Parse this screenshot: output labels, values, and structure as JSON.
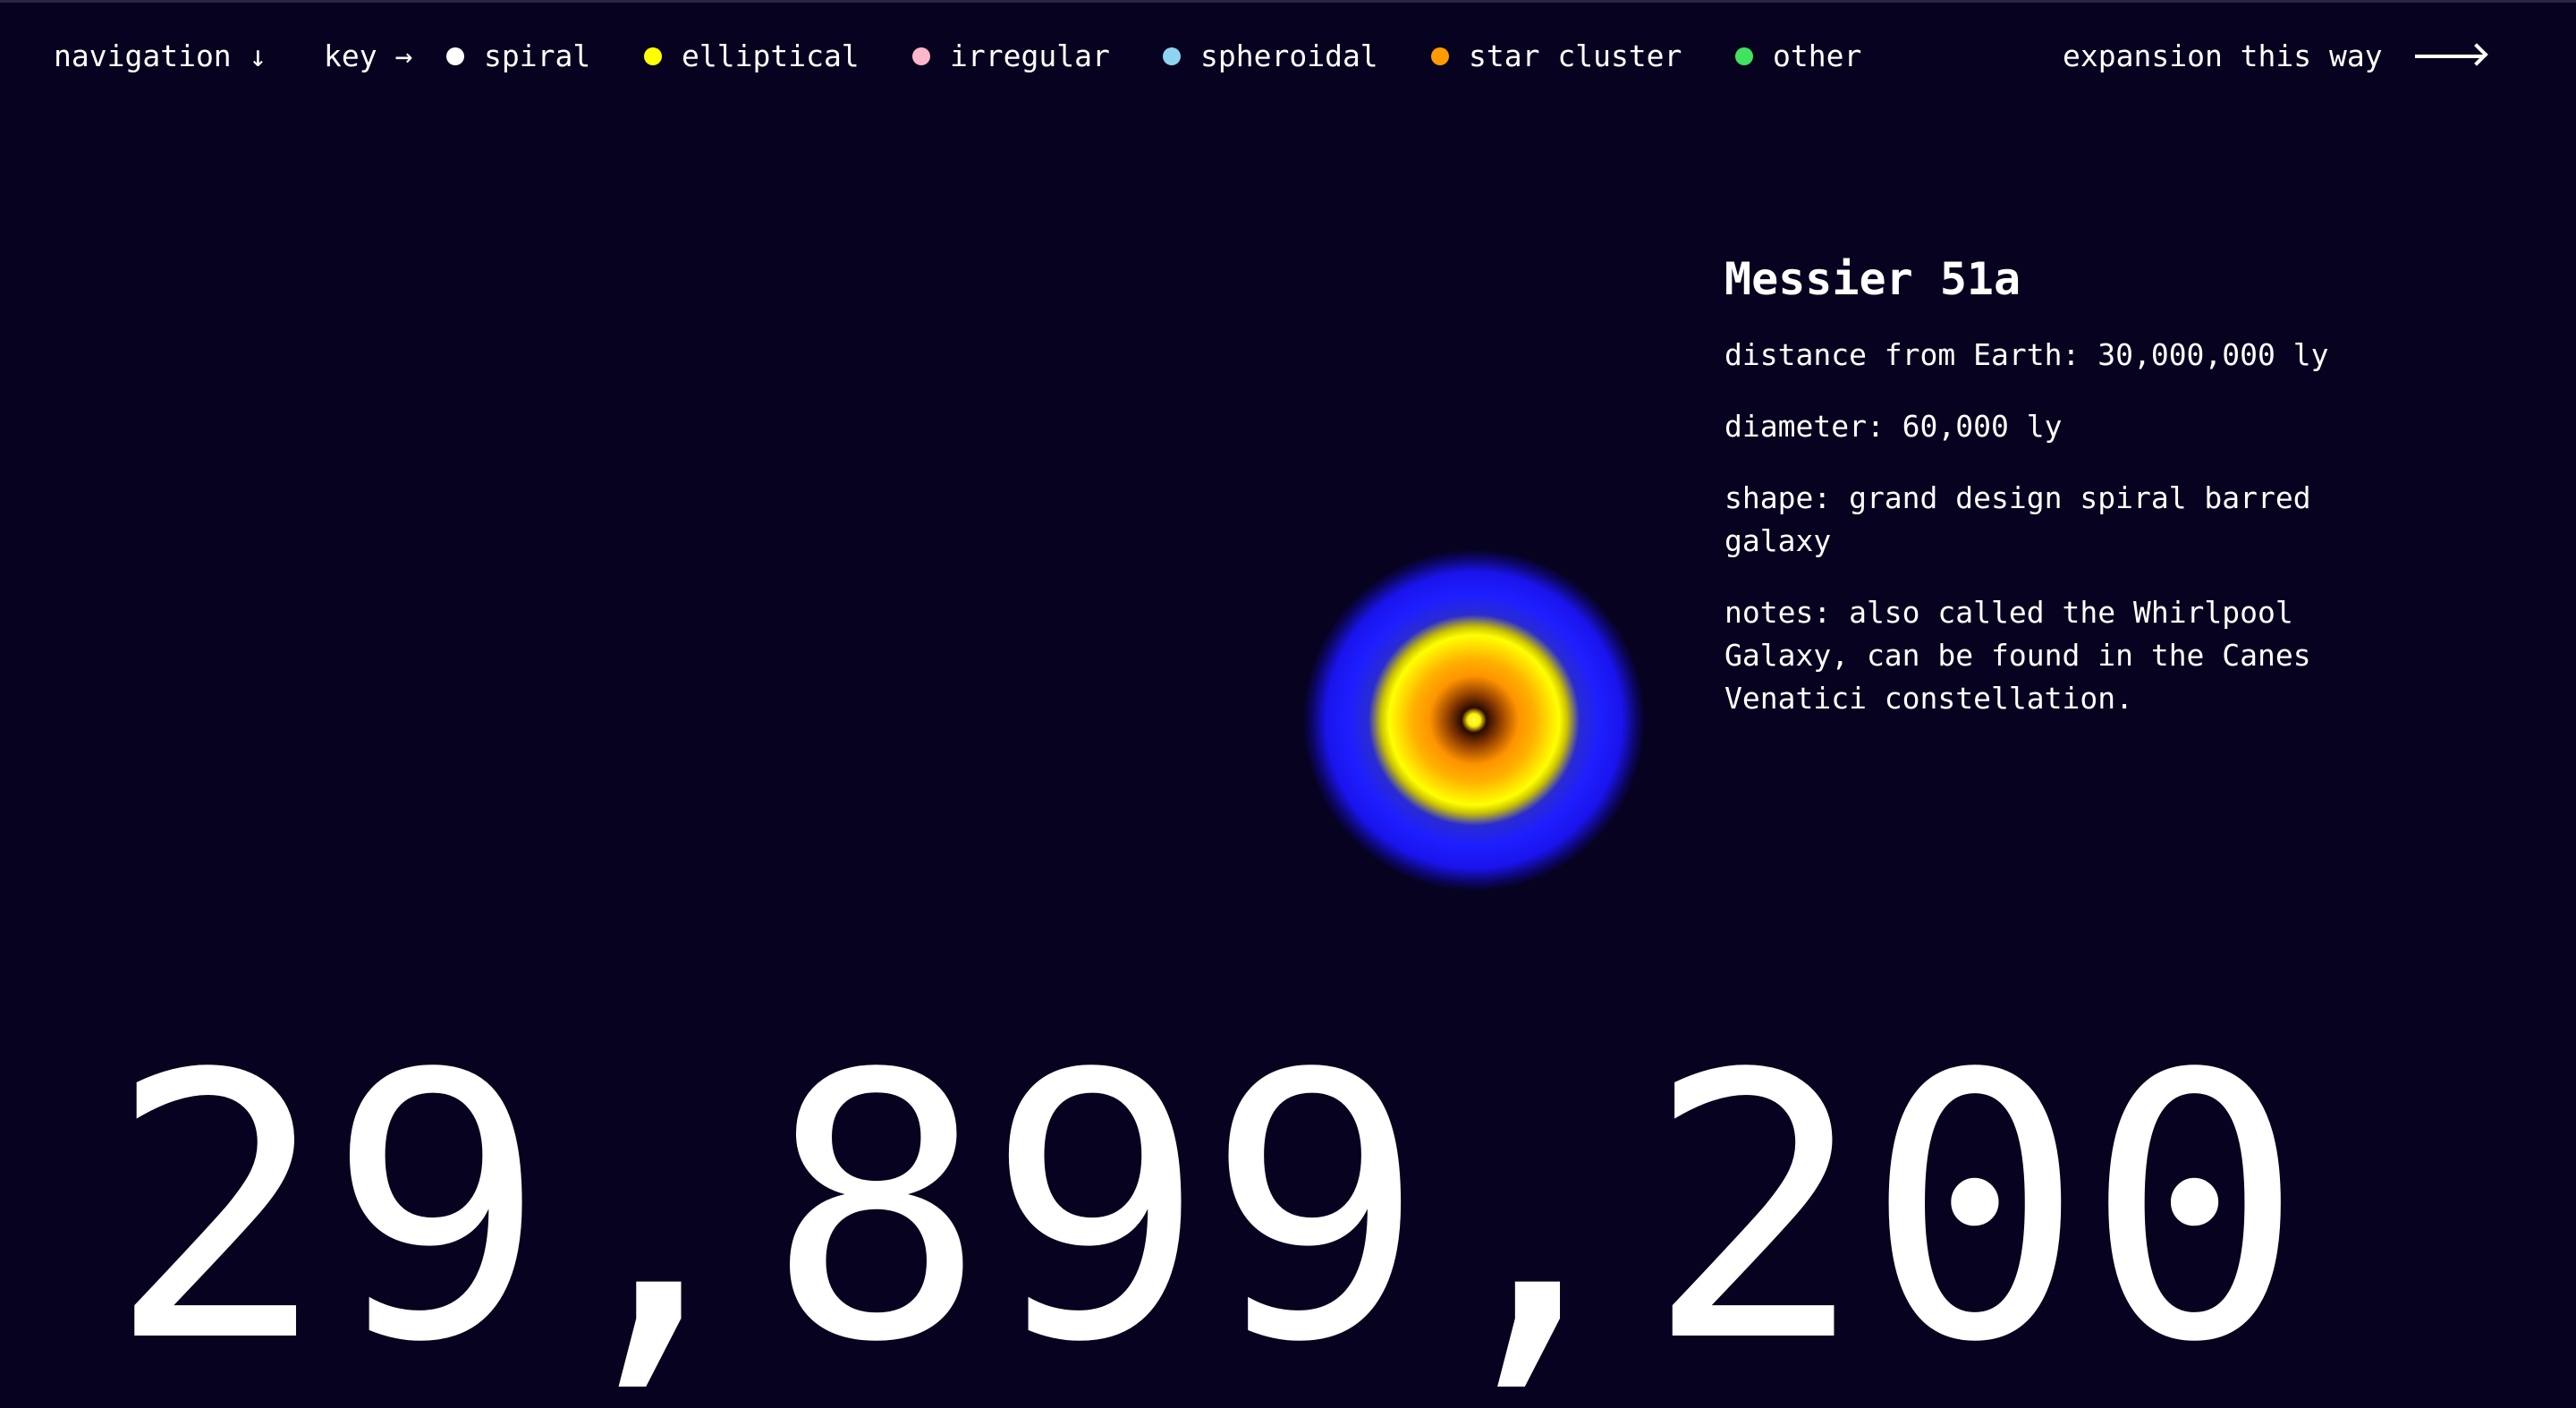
{
  "header": {
    "navigation_label": "navigation ↓",
    "key_label": "key →",
    "expansion_label": "expansion this way"
  },
  "legend": [
    {
      "label": "spiral",
      "color": "#ffffff"
    },
    {
      "label": "elliptical",
      "color": "#ffff00"
    },
    {
      "label": "irregular",
      "color": "#ffb6c8"
    },
    {
      "label": "spheroidal",
      "color": "#8fd3f0"
    },
    {
      "label": "star cluster",
      "color": "#ff9a00"
    },
    {
      "label": "other",
      "color": "#3fe35e"
    }
  ],
  "object": {
    "name": "Messier 51a",
    "distance": "distance from Earth: 30,000,000 ly",
    "diameter": "diameter: 60,000 ly",
    "shape": "shape: grand design spiral barred galaxy",
    "notes": "notes: also called the Whirlpool Galaxy, can be found in the Canes Venatici constellation.",
    "icon": "spiral-galaxy"
  },
  "counter": {
    "value": "29,899,200"
  },
  "colors": {
    "background": "#06021f",
    "text": "#ffffff"
  }
}
